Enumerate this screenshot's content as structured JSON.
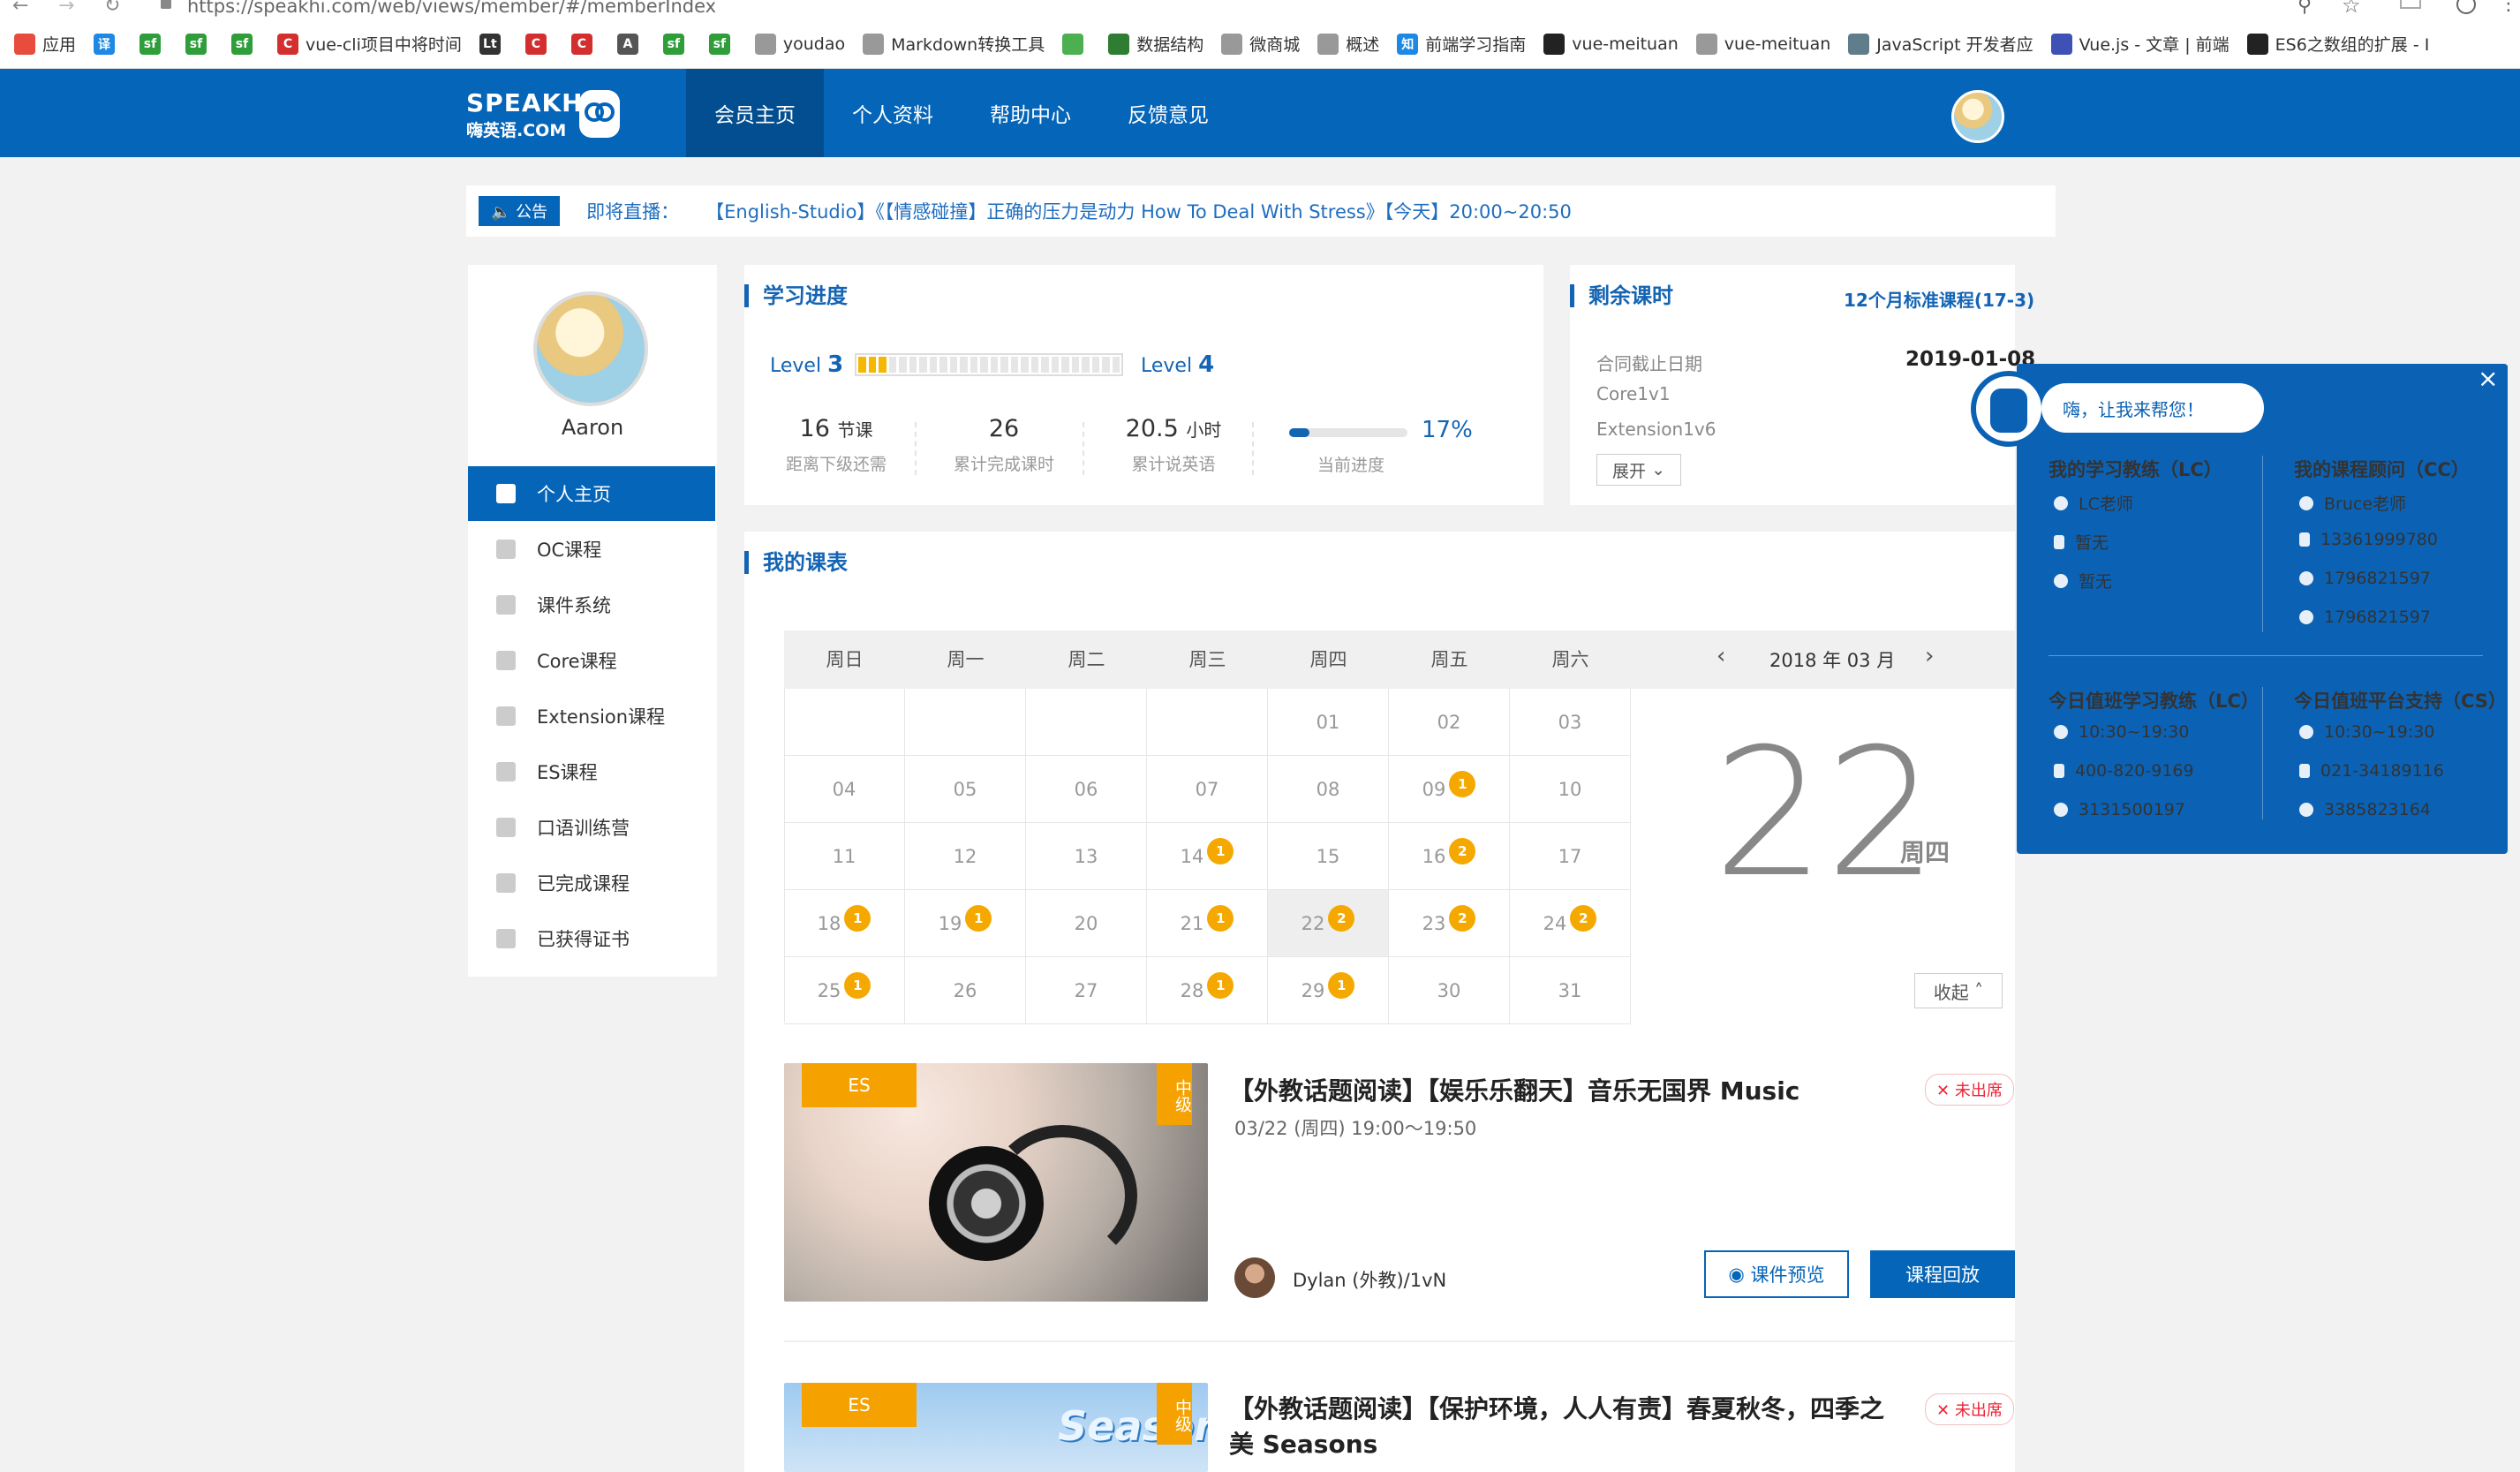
{
  "browser": {
    "url": "https://speakhi.com/web/views/member/#/memberIndex",
    "bookmarks": [
      {
        "label": "应用",
        "icon": "apps-icon",
        "color": "#e74c3c"
      },
      {
        "label": "",
        "icon": "translate-icon",
        "color": "#1e88e5",
        "text": "译"
      },
      {
        "label": "",
        "icon": "sf-icon",
        "color": "#2e9d3a",
        "text": "sf"
      },
      {
        "label": "",
        "icon": "sf-icon",
        "color": "#2e9d3a",
        "text": "sf"
      },
      {
        "label": "",
        "icon": "sf-icon",
        "color": "#2e9d3a",
        "text": "sf"
      },
      {
        "label": "vue-cli项目中将时间",
        "icon": "csdn-icon",
        "color": "#d32f2f",
        "text": "C"
      },
      {
        "label": "",
        "icon": "lt-icon",
        "color": "#333333",
        "text": "Lt"
      },
      {
        "label": "",
        "icon": "csdn-icon",
        "color": "#d32f2f",
        "text": "C"
      },
      {
        "label": "",
        "icon": "csdn-icon",
        "color": "#d32f2f",
        "text": "C"
      },
      {
        "label": "",
        "icon": "alpha-icon",
        "color": "#555555",
        "text": "A"
      },
      {
        "label": "",
        "icon": "sf-icon",
        "color": "#2e9d3a",
        "text": "sf"
      },
      {
        "label": "",
        "icon": "sf-icon",
        "color": "#2e9d3a",
        "text": "sf"
      },
      {
        "label": "youdao",
        "icon": "page-icon",
        "color": "#999999",
        "text": ""
      },
      {
        "label": "Markdown转换工具",
        "icon": "page-icon",
        "color": "#999999",
        "text": ""
      },
      {
        "label": "",
        "icon": "leaf-icon",
        "color": "#4caf50",
        "text": ""
      },
      {
        "label": "数据结构",
        "icon": "globe-icon",
        "color": "#2e7d32",
        "text": ""
      },
      {
        "label": "微商城",
        "icon": "page-icon",
        "color": "#999999",
        "text": ""
      },
      {
        "label": "概述",
        "icon": "page-icon",
        "color": "#999999",
        "text": ""
      },
      {
        "label": "前端学习指南",
        "icon": "zhihu-icon",
        "color": "#1e88e5",
        "text": "知"
      },
      {
        "label": "vue-meituan",
        "icon": "github-icon",
        "color": "#222222",
        "text": ""
      },
      {
        "label": "vue-meituan",
        "icon": "page-icon",
        "color": "#999999",
        "text": ""
      },
      {
        "label": "JavaScript 开发者应",
        "icon": "layers-icon",
        "color": "#607d8b",
        "text": ""
      },
      {
        "label": "Vue.js - 文章 | 前端",
        "icon": "shield-icon",
        "color": "#3f51b5",
        "text": ""
      },
      {
        "label": "ES6之数组的扩展 - I",
        "icon": "github-icon",
        "color": "#222222",
        "text": ""
      }
    ]
  },
  "header": {
    "logo_en": "SPEAKHI",
    "logo_cn": "嗨英语.COM",
    "nav": [
      {
        "label": "会员主页",
        "active": true
      },
      {
        "label": "个人资料",
        "active": false
      },
      {
        "label": "帮助中心",
        "active": false
      },
      {
        "label": "反馈意见",
        "active": false
      }
    ]
  },
  "notice": {
    "tag": "公告",
    "label": "即将直播：",
    "text": "【English-Studio】《【情感碰撞】正确的压力是动力 How To Deal With Stress》【今天】20:00~20:50"
  },
  "sidebar": {
    "username": "Aaron",
    "items": [
      {
        "label": "个人主页",
        "icon": "home-icon",
        "active": true
      },
      {
        "label": "OC课程",
        "icon": "oc-icon",
        "active": false
      },
      {
        "label": "课件系统",
        "icon": "folder-icon",
        "active": false
      },
      {
        "label": "Core课程",
        "icon": "gear-icon",
        "active": false
      },
      {
        "label": "Extension课程",
        "icon": "grid-icon",
        "active": false
      },
      {
        "label": "ES课程",
        "icon": "book-icon",
        "active": false
      },
      {
        "label": "口语训练营",
        "icon": "chat-icon",
        "active": false
      },
      {
        "label": "已完成课程",
        "icon": "check-icon",
        "active": false
      },
      {
        "label": "已获得证书",
        "icon": "certificate-icon",
        "active": false
      }
    ]
  },
  "progress": {
    "title": "学习进度",
    "level_from_prefix": "Level",
    "level_from": "3",
    "level_to_prefix": "Level",
    "level_to": "4",
    "level_fill": 0.1,
    "stats": [
      {
        "value": "16",
        "unit": "节课",
        "label": "距离下级还需"
      },
      {
        "value": "26",
        "unit": "",
        "label": "累计完成课时"
      },
      {
        "value": "20.5",
        "unit": "小时",
        "label": "累计说英语"
      }
    ],
    "percent_label": "17%",
    "percent_value": 0.17,
    "percent_caption": "当前进度"
  },
  "remaining": {
    "title": "剩余课时",
    "plan": "12个月标准课程(17-3)",
    "rows": [
      {
        "label": "合同截止日期",
        "value": "2019-01-08"
      },
      {
        "label": "Core1v1",
        "value": ""
      },
      {
        "label": "Extension1v6",
        "value": ""
      }
    ],
    "expand_label": "展开"
  },
  "schedule": {
    "title": "我的课表",
    "weekdays": [
      "周日",
      "周一",
      "周二",
      "周三",
      "周四",
      "周五",
      "周六"
    ],
    "month_label": "2018 年 03 月",
    "today_big": "22",
    "today_weekday": "周四",
    "collapse_label": "收起",
    "weeks": [
      [
        {
          "d": ""
        },
        {
          "d": ""
        },
        {
          "d": ""
        },
        {
          "d": ""
        },
        {
          "d": "01"
        },
        {
          "d": "02"
        },
        {
          "d": "03"
        }
      ],
      [
        {
          "d": "04"
        },
        {
          "d": "05"
        },
        {
          "d": "06"
        },
        {
          "d": "07"
        },
        {
          "d": "08"
        },
        {
          "d": "09",
          "t": "1"
        },
        {
          "d": "10"
        }
      ],
      [
        {
          "d": "11"
        },
        {
          "d": "12"
        },
        {
          "d": "13"
        },
        {
          "d": "14",
          "t": "1"
        },
        {
          "d": "15"
        },
        {
          "d": "16",
          "t": "2"
        },
        {
          "d": "17"
        }
      ],
      [
        {
          "d": "18",
          "t": "1"
        },
        {
          "d": "19",
          "t": "1"
        },
        {
          "d": "20"
        },
        {
          "d": "21",
          "t": "1"
        },
        {
          "d": "22",
          "t": "2",
          "today": true
        },
        {
          "d": "23",
          "t": "2"
        },
        {
          "d": "24",
          "t": "2"
        }
      ],
      [
        {
          "d": "25",
          "t": "1"
        },
        {
          "d": "26"
        },
        {
          "d": "27"
        },
        {
          "d": "28",
          "t": "1"
        },
        {
          "d": "29",
          "t": "1"
        },
        {
          "d": "30"
        },
        {
          "d": "31"
        }
      ]
    ]
  },
  "courses": [
    {
      "tag": "ES",
      "level": "中级",
      "title": "【外教话题阅读】【娱乐乐翻天】音乐无国界 Music",
      "time": "03/22 (周四) 19:00～19:50",
      "status": "未出席",
      "teacher": "Dylan (外教)/1vN",
      "preview_label": "课件预览",
      "replay_label": "课程回放"
    },
    {
      "tag": "ES",
      "level": "中级",
      "title": "【外教话题阅读】【保护环境，人人有责】春夏秋冬，四季之美 Seasons",
      "time": "",
      "status": "未出席",
      "image_text": "Seasons"
    }
  ],
  "help": {
    "greeting": "嗨，让我来帮您！",
    "lc_title": "我的学习教练（LC）",
    "lc_items": [
      "LC老师",
      "暂无",
      "暂无"
    ],
    "cc_title": "我的课程顾问（CC）",
    "cc_items": [
      "Bruce老师",
      "13361999780",
      "1796821597",
      "1796821597"
    ],
    "duty_lc_title": "今日值班学习教练（LC）",
    "duty_lc_items": [
      "10:30~19:30",
      "400-820-9169",
      "3131500197"
    ],
    "duty_cs_title": "今日值班平台支持（CS）",
    "duty_cs_items": [
      "10:30~19:30",
      "021-34189116",
      "3385823164"
    ]
  }
}
